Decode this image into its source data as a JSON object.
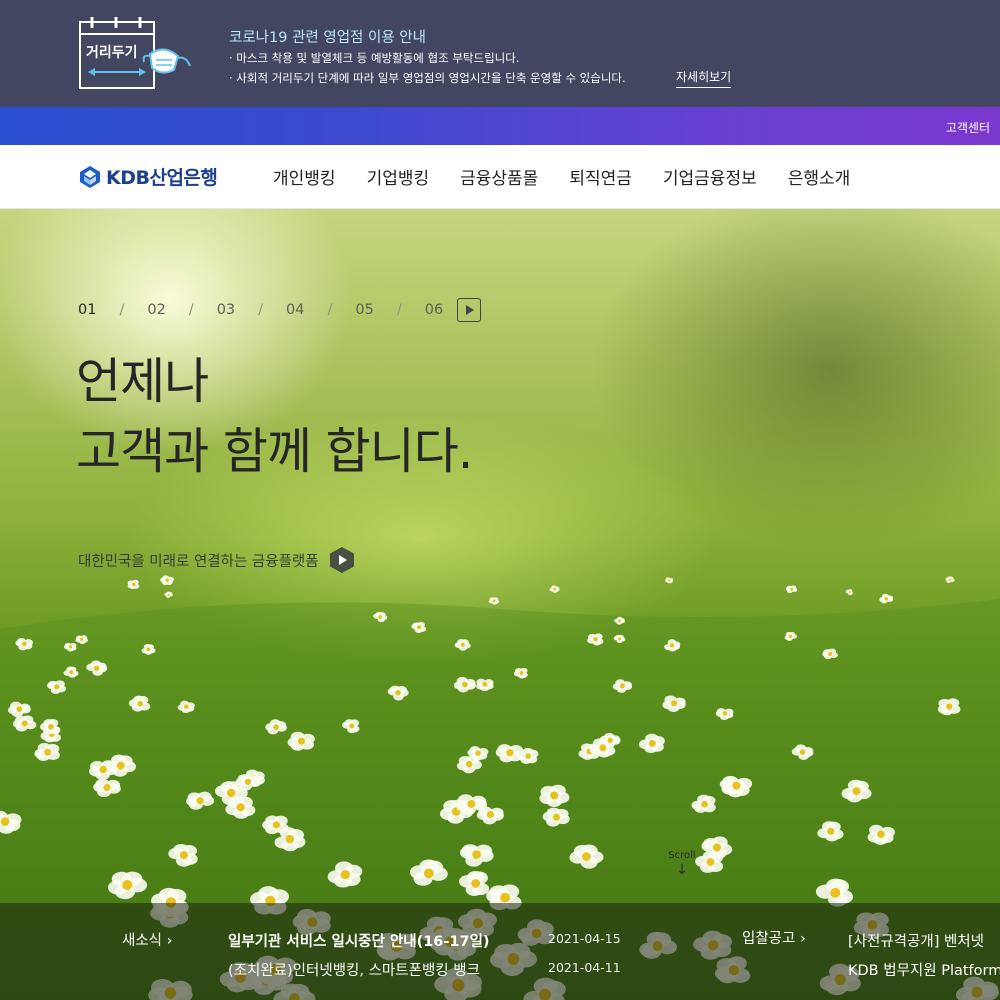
{
  "notice": {
    "icon_label": "거리두기",
    "icon": "calendar-mask-icon",
    "title": "코로나19 관련 영업점 이용 안내",
    "lines": [
      "· 마스크 착용 및 발열체크 등 예방활동에 협조 부탁드립니다.",
      "· 사회적 거리두기 단계에 따라 일부 영업점의 영업시간을 단축 운영할 수 있습니다."
    ],
    "more_label": "자세히보기"
  },
  "topbar": {
    "customer_center": "고객센터"
  },
  "brand": {
    "name": "KDB산업은행",
    "logo_icon": "kdb-logo-icon",
    "color": "#1c3f8e"
  },
  "menu": [
    "개인뱅킹",
    "기업뱅킹",
    "금융상품몰",
    "퇴직연금",
    "기업금융정보",
    "은행소개"
  ],
  "hero": {
    "slides": [
      "01",
      "02",
      "03",
      "04",
      "05",
      "06"
    ],
    "active_slide": "01",
    "separator": "/",
    "headline_lines": [
      "언제나",
      "고객과 함께 합니다."
    ],
    "subline": "대한민국을 미래로 연결하는 금융플랫폼",
    "scroll_label": "Scroll"
  },
  "news": {
    "label": "새소식",
    "items": [
      {
        "title": "일부기관 서비스 일시중단 안내(16-17일)",
        "date": "2021-04-15"
      },
      {
        "title": "(조치완료)인터넷뱅킹, 스마트폰뱅킹 뱅크",
        "date": "2021-04-11"
      }
    ]
  },
  "bids": {
    "label": "입찰공고",
    "items": [
      {
        "title": "[사전규격공개] 벤처넷"
      },
      {
        "title": "KDB 법무지원 Platform"
      }
    ]
  },
  "colors": {
    "notice_bg": "#434660",
    "gradient_start": "#2a4fd0",
    "gradient_end": "#7b38cf",
    "notice_title": "#bfe5ff"
  }
}
